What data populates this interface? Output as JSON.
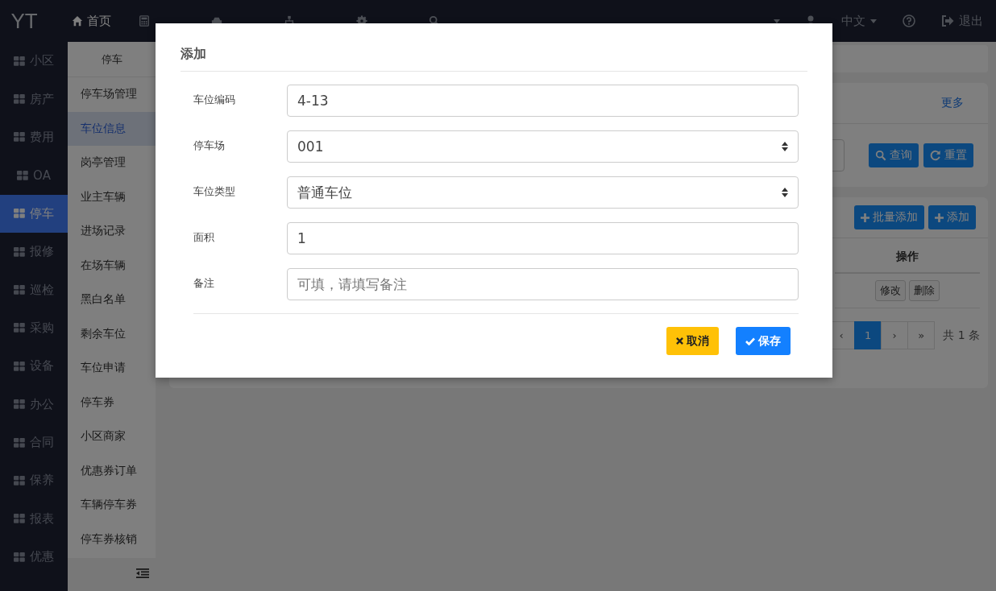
{
  "topbar": {
    "logo": "YT",
    "nav": [
      {
        "label": "首页",
        "selected": true
      }
    ],
    "language": "中文",
    "logout": "退出"
  },
  "sidebar": {
    "items": [
      {
        "label": "小区",
        "selected": false
      },
      {
        "label": "房产",
        "selected": false
      },
      {
        "label": "费用",
        "selected": false
      },
      {
        "label": "OA",
        "selected": false
      },
      {
        "label": "停车",
        "selected": true
      },
      {
        "label": "报修",
        "selected": false
      },
      {
        "label": "巡检",
        "selected": false
      },
      {
        "label": "采购",
        "selected": false
      },
      {
        "label": "设备",
        "selected": false
      },
      {
        "label": "办公",
        "selected": false
      },
      {
        "label": "合同",
        "selected": false
      },
      {
        "label": "保养",
        "selected": false
      },
      {
        "label": "报表",
        "selected": false
      },
      {
        "label": "优惠",
        "selected": false
      }
    ]
  },
  "submenu": {
    "title": "停车",
    "items": [
      {
        "label": "停车场管理",
        "selected": false
      },
      {
        "label": "车位信息",
        "selected": true
      },
      {
        "label": "岗亭管理",
        "selected": false
      },
      {
        "label": "业主车辆",
        "selected": false
      },
      {
        "label": "进场记录",
        "selected": false
      },
      {
        "label": "在场车辆",
        "selected": false
      },
      {
        "label": "黑白名单",
        "selected": false
      },
      {
        "label": "剩余车位",
        "selected": false
      },
      {
        "label": "车位申请",
        "selected": false
      },
      {
        "label": "停车券",
        "selected": false
      },
      {
        "label": "小区商家",
        "selected": false
      },
      {
        "label": "优惠券订单",
        "selected": false
      },
      {
        "label": "车辆停车券",
        "selected": false
      },
      {
        "label": "停车券核销",
        "selected": false
      }
    ]
  },
  "search_card": {
    "more_link": "更多",
    "buttons": [
      {
        "label": "查询"
      },
      {
        "label": "重置"
      }
    ]
  },
  "list_card": {
    "buttons": [
      {
        "label": "批量添加"
      },
      {
        "label": "添加"
      }
    ],
    "table": {
      "columns": [
        "操作"
      ],
      "row_actions": [
        "修改",
        "删除"
      ]
    },
    "pagination": {
      "pages": [
        {
          "label": "‹",
          "selected": false
        },
        {
          "label": "1",
          "selected": true
        },
        {
          "label": "›",
          "selected": false
        },
        {
          "label": "»",
          "selected": false
        }
      ],
      "total": "共 1 条"
    }
  },
  "modal": {
    "title": "添加",
    "fields": [
      {
        "label": "车位编码",
        "kind": "input",
        "value": "4-13"
      },
      {
        "label": "停车场",
        "kind": "select",
        "value": "001"
      },
      {
        "label": "车位类型",
        "kind": "select",
        "value": "普通车位"
      },
      {
        "label": "面积",
        "kind": "input",
        "value": "1"
      },
      {
        "label": "备注",
        "kind": "input",
        "placeholder": "可填，请填写备注"
      }
    ],
    "buttons": [
      {
        "label": "取消",
        "kind": "cancel"
      },
      {
        "label": "保存",
        "kind": "save"
      }
    ]
  }
}
